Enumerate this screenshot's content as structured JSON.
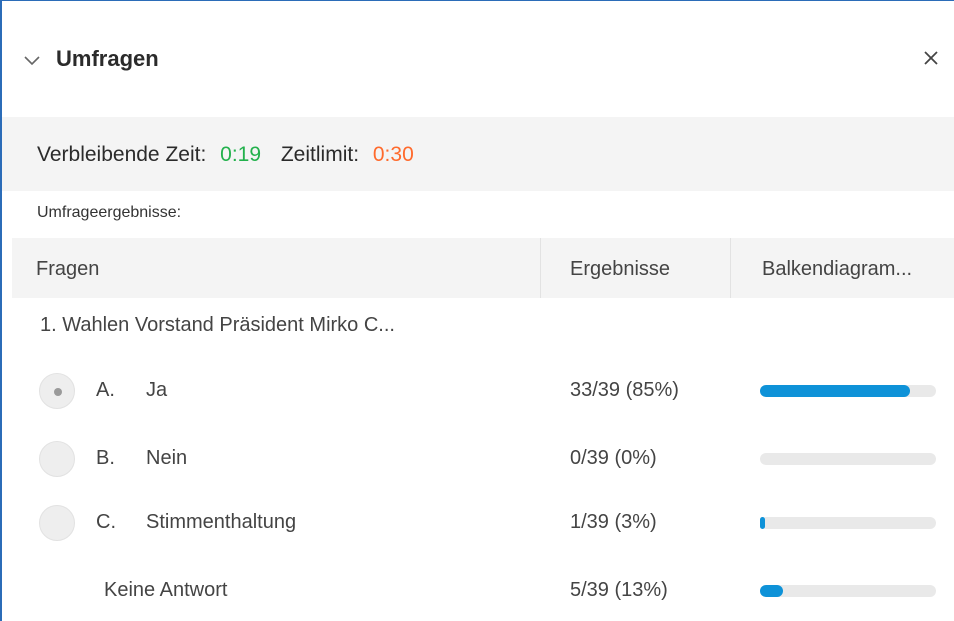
{
  "panel": {
    "title": "Umfragen",
    "icons": {
      "collapse": "chevron-down-icon",
      "close": "close-icon"
    }
  },
  "timer": {
    "remaining_label": "Verbleibende Zeit:",
    "remaining_value": "0:19",
    "limit_label": "Zeitlimit:",
    "limit_value": "0:30",
    "colors": {
      "remaining": "#22b14c",
      "limit": "#ff6a2c"
    }
  },
  "results": {
    "label": "Umfrageergebnisse:",
    "columns": [
      "Fragen",
      "Ergebnisse",
      "Balkendiagram..."
    ],
    "question": "1. Wahlen Vorstand Präsident Mirko C...",
    "bar_color": "#0e92d8",
    "options": [
      {
        "letter": "A.",
        "label": "Ja",
        "result": "33/39 (85%)",
        "fraction": 0.85,
        "selected": true
      },
      {
        "letter": "B.",
        "label": "Nein",
        "result": "0/39 (0%)",
        "fraction": 0.0,
        "selected": false
      },
      {
        "letter": "C.",
        "label": "Stimmenthaltung",
        "result": "1/39 (3%)",
        "fraction": 0.03,
        "selected": false
      }
    ],
    "no_answer": {
      "label": "Keine Antwort",
      "result": "5/39 (13%)",
      "fraction": 0.13
    }
  }
}
